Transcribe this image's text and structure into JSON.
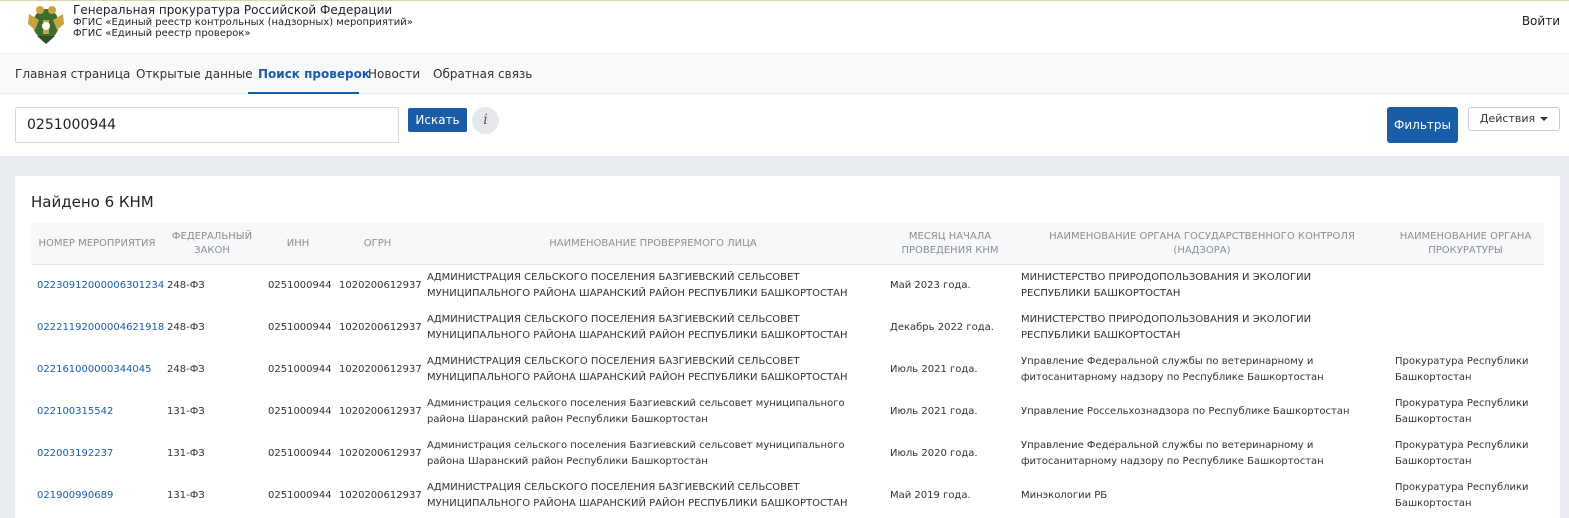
{
  "header": {
    "title": "Генеральная прокуратура Российской Федерации",
    "subtitle1": "ФГИС «Единый реестр контрольных (надзорных) мероприятий»",
    "subtitle2": "ФГИС «Единый реестр проверок»",
    "login_label": "Войти",
    "emblem_icon": "emblem-icon"
  },
  "nav": {
    "items": [
      {
        "label": "Главная страница"
      },
      {
        "label": "Открытые данные"
      },
      {
        "label": "Поиск проверок"
      },
      {
        "label": "Новости"
      },
      {
        "label": "Обратная связь"
      }
    ],
    "active_index": 2
  },
  "search": {
    "value": "0251000944",
    "search_button": "Искать",
    "info_button": "i",
    "filters_button": "Фильтры",
    "actions_button": "Действия"
  },
  "results": {
    "found_text": "Найдено 6 КНМ",
    "columns": [
      "Номер мероприятия",
      "Федеральный закон",
      "ИНН",
      "ОГРН",
      "Наименование проверяемого лица",
      "Месяц начала проведения КНМ",
      "Наименование органа государственного контроля (надзора)",
      "Наименование органа прокуратуры"
    ],
    "rows": [
      {
        "number": "02230912000006301234",
        "law": "248-ФЗ",
        "inn": "0251000944",
        "ogrn": "1020200612937",
        "subject": "АДМИНИСТРАЦИЯ СЕЛЬСКОГО ПОСЕЛЕНИЯ БАЗГИЕВСКИЙ СЕЛЬСОВЕТ МУНИЦИПАЛЬНОГО РАЙОНА ШАРАНСКИЙ РАЙОН РЕСПУБЛИКИ БАШКОРТОСТАН",
        "month": "Май 2023 года.",
        "authority": "МИНИСТЕРСТВО ПРИРОДОПОЛЬЗОВАНИЯ И ЭКОЛОГИИ РЕСПУБЛИКИ БАШКОРТОСТАН",
        "prosecutor": ""
      },
      {
        "number": "02221192000004621918",
        "law": "248-ФЗ",
        "inn": "0251000944",
        "ogrn": "1020200612937",
        "subject": "АДМИНИСТРАЦИЯ СЕЛЬСКОГО ПОСЕЛЕНИЯ БАЗГИЕВСКИЙ СЕЛЬСОВЕТ МУНИЦИПАЛЬНОГО РАЙОНА ШАРАНСКИЙ РАЙОН РЕСПУБЛИКИ БАШКОРТОСТАН",
        "month": "Декабрь 2022 года.",
        "authority": "МИНИСТЕРСТВО ПРИРОДОПОЛЬЗОВАНИЯ И ЭКОЛОГИИ РЕСПУБЛИКИ БАШКОРТОСТАН",
        "prosecutor": ""
      },
      {
        "number": "022161000000344045",
        "law": "248-ФЗ",
        "inn": "0251000944",
        "ogrn": "1020200612937",
        "subject": "АДМИНИСТРАЦИЯ СЕЛЬСКОГО ПОСЕЛЕНИЯ БАЗГИЕВСКИЙ СЕЛЬСОВЕТ МУНИЦИПАЛЬНОГО РАЙОНА ШАРАНСКИЙ РАЙОН РЕСПУБЛИКИ БАШКОРТОСТАН",
        "month": "Июль 2021 года.",
        "authority": "Управление Федеральной службы по ветеринарному и фитосанитарному надзору по Республике Башкортостан",
        "prosecutor": "Прокуратура Республики Башкортостан"
      },
      {
        "number": "022100315542",
        "law": "131-ФЗ",
        "inn": "0251000944",
        "ogrn": "1020200612937",
        "subject": "Администрация сельского поселения Базгиевский сельсовет муниципального района Шаранский район Республики Башкортостан",
        "month": "Июль 2021 года.",
        "authority": "Управление Россельхознадзора по Республике Башкортостан",
        "prosecutor": "Прокуратура Республики Башкортостан"
      },
      {
        "number": "022003192237",
        "law": "131-ФЗ",
        "inn": "0251000944",
        "ogrn": "1020200612937",
        "subject": "Администрация сельского поселения Базгиевский сельсовет муниципального района Шаранский район Республики Башкортостан",
        "month": "Июль 2020 года.",
        "authority": "Управление Федеральной службы по ветеринарному и фитосанитарному надзору по Республике Башкортостан",
        "prosecutor": "Прокуратура Республики Башкортостан"
      },
      {
        "number": "021900990689",
        "law": "131-ФЗ",
        "inn": "0251000944",
        "ogrn": "1020200612937",
        "subject": "АДМИНИСТРАЦИЯ СЕЛЬСКОГО ПОСЕЛЕНИЯ БАЗГИЕВСКИЙ СЕЛЬСОВЕТ МУНИЦИПАЛЬНОГО РАЙОНА ШАРАНСКИЙ РАЙОН РЕСПУБЛИКИ БАШКОРТОСТАН",
        "month": "Май 2019 года.",
        "authority": "Минэкологии РБ",
        "prosecutor": "Прокуратура Республики Башкортостан"
      }
    ]
  },
  "colors": {
    "accent": "#1a5da7",
    "page_bg": "#e9ecf1"
  }
}
